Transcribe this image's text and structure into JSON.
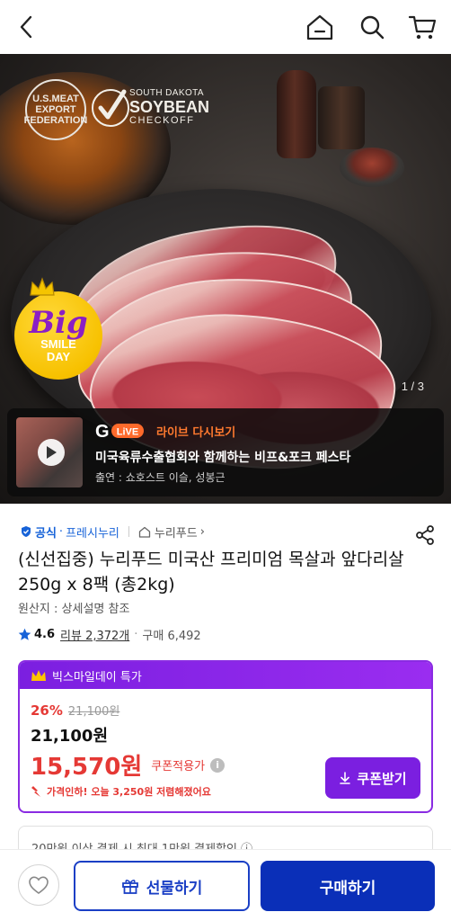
{
  "header": {
    "icons": [
      "back-icon",
      "home-icon",
      "search-icon",
      "cart-icon"
    ]
  },
  "hero": {
    "logo_usmeat": "U.S.MEAT EXPORT FEDERATION",
    "logo_soy_line1": "SOUTH DAKOTA",
    "logo_soy_line2": "SOYBEAN",
    "logo_soy_line3": "CHECKOFF",
    "badge_big": "Big",
    "badge_smile": "SMILE",
    "badge_day": "DAY",
    "counter": "1 / 3"
  },
  "live": {
    "brand_g": "G",
    "brand_live": "LiVE",
    "label": "라이브 다시보기",
    "title": "미국육류수출협회와 함께하는 비프&포크 페스타",
    "cast": "출연 : 쇼호스트 이슬, 성봉근"
  },
  "product": {
    "badge_official": "공식",
    "badge_fresh": "프레시누리",
    "store": "누리푸드",
    "title": "(신선집중) 누리푸드 미국산 프리미엄 목살과 앞다리살 250g x 8팩 (총2kg)",
    "origin": "원산지 : 상세설명 참조",
    "rating": "4.6",
    "reviews": "리뷰 2,372개",
    "purchases": "구매 6,492"
  },
  "deal": {
    "header": "빅스마일데이 특가",
    "discount": "26%",
    "strike_price": "21,100원",
    "original_price": "21,100원",
    "sale_price": "15,570원",
    "coupon_applied": "쿠폰적용가",
    "info": "i",
    "price_drop": "가격인하! 오늘 3,250원 저렴해졌어요",
    "coupon_button": "쿠폰받기"
  },
  "promo": {
    "text": "20만원 이상 결제 시 최대 1만원 결제할인 ⓘ"
  },
  "bottom": {
    "gift": "선물하기",
    "buy": "구매하기"
  },
  "colors": {
    "accent_purple": "#7b1fe0",
    "sale_red": "#e53935",
    "buy_blue": "#0a2fb8",
    "link_blue": "#1662d8"
  }
}
